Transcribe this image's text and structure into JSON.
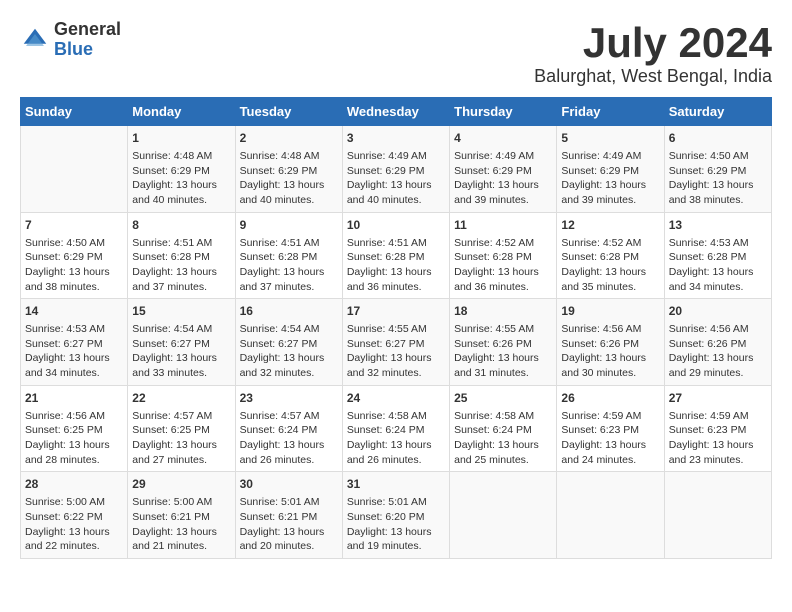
{
  "header": {
    "logo_general": "General",
    "logo_blue": "Blue",
    "title": "July 2024",
    "subtitle": "Balurghat, West Bengal, India"
  },
  "calendar": {
    "days": [
      "Sunday",
      "Monday",
      "Tuesday",
      "Wednesday",
      "Thursday",
      "Friday",
      "Saturday"
    ],
    "weeks": [
      [
        {
          "date": "",
          "content": ""
        },
        {
          "date": "1",
          "content": "Sunrise: 4:48 AM\nSunset: 6:29 PM\nDaylight: 13 hours\nand 40 minutes."
        },
        {
          "date": "2",
          "content": "Sunrise: 4:48 AM\nSunset: 6:29 PM\nDaylight: 13 hours\nand 40 minutes."
        },
        {
          "date": "3",
          "content": "Sunrise: 4:49 AM\nSunset: 6:29 PM\nDaylight: 13 hours\nand 40 minutes."
        },
        {
          "date": "4",
          "content": "Sunrise: 4:49 AM\nSunset: 6:29 PM\nDaylight: 13 hours\nand 39 minutes."
        },
        {
          "date": "5",
          "content": "Sunrise: 4:49 AM\nSunset: 6:29 PM\nDaylight: 13 hours\nand 39 minutes."
        },
        {
          "date": "6",
          "content": "Sunrise: 4:50 AM\nSunset: 6:29 PM\nDaylight: 13 hours\nand 38 minutes."
        }
      ],
      [
        {
          "date": "7",
          "content": "Sunrise: 4:50 AM\nSunset: 6:29 PM\nDaylight: 13 hours\nand 38 minutes."
        },
        {
          "date": "8",
          "content": "Sunrise: 4:51 AM\nSunset: 6:28 PM\nDaylight: 13 hours\nand 37 minutes."
        },
        {
          "date": "9",
          "content": "Sunrise: 4:51 AM\nSunset: 6:28 PM\nDaylight: 13 hours\nand 37 minutes."
        },
        {
          "date": "10",
          "content": "Sunrise: 4:51 AM\nSunset: 6:28 PM\nDaylight: 13 hours\nand 36 minutes."
        },
        {
          "date": "11",
          "content": "Sunrise: 4:52 AM\nSunset: 6:28 PM\nDaylight: 13 hours\nand 36 minutes."
        },
        {
          "date": "12",
          "content": "Sunrise: 4:52 AM\nSunset: 6:28 PM\nDaylight: 13 hours\nand 35 minutes."
        },
        {
          "date": "13",
          "content": "Sunrise: 4:53 AM\nSunset: 6:28 PM\nDaylight: 13 hours\nand 34 minutes."
        }
      ],
      [
        {
          "date": "14",
          "content": "Sunrise: 4:53 AM\nSunset: 6:27 PM\nDaylight: 13 hours\nand 34 minutes."
        },
        {
          "date": "15",
          "content": "Sunrise: 4:54 AM\nSunset: 6:27 PM\nDaylight: 13 hours\nand 33 minutes."
        },
        {
          "date": "16",
          "content": "Sunrise: 4:54 AM\nSunset: 6:27 PM\nDaylight: 13 hours\nand 32 minutes."
        },
        {
          "date": "17",
          "content": "Sunrise: 4:55 AM\nSunset: 6:27 PM\nDaylight: 13 hours\nand 32 minutes."
        },
        {
          "date": "18",
          "content": "Sunrise: 4:55 AM\nSunset: 6:26 PM\nDaylight: 13 hours\nand 31 minutes."
        },
        {
          "date": "19",
          "content": "Sunrise: 4:56 AM\nSunset: 6:26 PM\nDaylight: 13 hours\nand 30 minutes."
        },
        {
          "date": "20",
          "content": "Sunrise: 4:56 AM\nSunset: 6:26 PM\nDaylight: 13 hours\nand 29 minutes."
        }
      ],
      [
        {
          "date": "21",
          "content": "Sunrise: 4:56 AM\nSunset: 6:25 PM\nDaylight: 13 hours\nand 28 minutes."
        },
        {
          "date": "22",
          "content": "Sunrise: 4:57 AM\nSunset: 6:25 PM\nDaylight: 13 hours\nand 27 minutes."
        },
        {
          "date": "23",
          "content": "Sunrise: 4:57 AM\nSunset: 6:24 PM\nDaylight: 13 hours\nand 26 minutes."
        },
        {
          "date": "24",
          "content": "Sunrise: 4:58 AM\nSunset: 6:24 PM\nDaylight: 13 hours\nand 26 minutes."
        },
        {
          "date": "25",
          "content": "Sunrise: 4:58 AM\nSunset: 6:24 PM\nDaylight: 13 hours\nand 25 minutes."
        },
        {
          "date": "26",
          "content": "Sunrise: 4:59 AM\nSunset: 6:23 PM\nDaylight: 13 hours\nand 24 minutes."
        },
        {
          "date": "27",
          "content": "Sunrise: 4:59 AM\nSunset: 6:23 PM\nDaylight: 13 hours\nand 23 minutes."
        }
      ],
      [
        {
          "date": "28",
          "content": "Sunrise: 5:00 AM\nSunset: 6:22 PM\nDaylight: 13 hours\nand 22 minutes."
        },
        {
          "date": "29",
          "content": "Sunrise: 5:00 AM\nSunset: 6:21 PM\nDaylight: 13 hours\nand 21 minutes."
        },
        {
          "date": "30",
          "content": "Sunrise: 5:01 AM\nSunset: 6:21 PM\nDaylight: 13 hours\nand 20 minutes."
        },
        {
          "date": "31",
          "content": "Sunrise: 5:01 AM\nSunset: 6:20 PM\nDaylight: 13 hours\nand 19 minutes."
        },
        {
          "date": "",
          "content": ""
        },
        {
          "date": "",
          "content": ""
        },
        {
          "date": "",
          "content": ""
        }
      ]
    ]
  }
}
